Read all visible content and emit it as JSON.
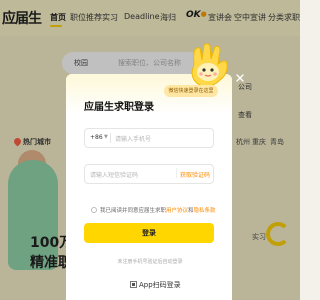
{
  "brand": {
    "logo": "应届生"
  },
  "nav": {
    "items": [
      "首页",
      "职位推荐",
      "实习",
      "Deadline",
      "海归",
      "宣讲会",
      "空中宣讲",
      "分类求职"
    ],
    "ok_badge": "OK"
  },
  "search": {
    "category": "校园",
    "placeholder": "搜索职位、公司名称"
  },
  "hot_cities": {
    "label": "热门城市",
    "cities": [
      "杭州",
      "重庆",
      "青岛"
    ]
  },
  "side": {
    "col1": "公司",
    "col2": "查看",
    "link": "实习"
  },
  "slogan": {
    "line1": "100万+",
    "line2": "精准职"
  },
  "modal": {
    "tip": "微信快速登录在这里",
    "title": "应届生求职登录",
    "country_code": "+86",
    "phone_placeholder": "请输入手机号",
    "code_placeholder": "请输入短信验证码",
    "get_code": "获取验证码",
    "agree_prefix": "我已阅读并同意应届生求职",
    "agree_user": "用户协议",
    "agree_and": "和",
    "agree_privacy": "隐私条款",
    "login_button": "登录",
    "auto_register": "未注册手机号验证后自动登录",
    "app_login": "App扫码登录"
  },
  "colors": {
    "brand_yellow": "#ffd600",
    "link_orange": "#ff8a00",
    "topbar_bg": "#fbf5c9"
  }
}
